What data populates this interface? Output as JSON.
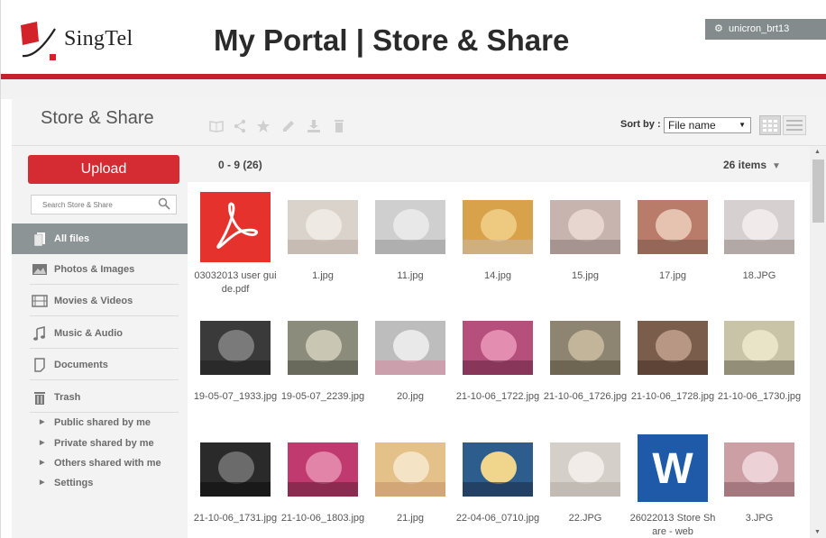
{
  "header": {
    "logo_text": "SingTel",
    "title": "My Portal  |  Store & Share",
    "user": "unicron_brt13"
  },
  "sidebar": {
    "title": "Store & Share",
    "upload_label": "Upload",
    "search_placeholder": "Search Store & Share",
    "nav": [
      {
        "label": "All files",
        "icon": "files-icon",
        "active": true
      },
      {
        "label": "Photos & Images",
        "icon": "image-icon"
      },
      {
        "label": "Movies & Videos",
        "icon": "film-icon"
      },
      {
        "label": "Music & Audio",
        "icon": "music-icon"
      },
      {
        "label": "Documents",
        "icon": "document-icon"
      },
      {
        "label": "Trash",
        "icon": "trash-icon"
      }
    ],
    "sub": [
      {
        "label": "Public shared by me"
      },
      {
        "label": "Private shared by me"
      },
      {
        "label": "Others shared with me"
      },
      {
        "label": "Settings"
      }
    ]
  },
  "toolbar": {
    "icons": [
      "book-icon",
      "share-icon",
      "star-icon",
      "edit-icon",
      "download-icon",
      "trash-icon"
    ],
    "sort_label": "Sort by :",
    "sort_value": "File name",
    "view_icons": [
      "grid-view-icon",
      "list-view-icon"
    ]
  },
  "content": {
    "range": "0 - 9 (26)",
    "count": "26 items",
    "files": [
      {
        "name": "03032013 user guide.pdf",
        "kind": "pdf"
      },
      {
        "name": "1.jpg",
        "kind": "photo"
      },
      {
        "name": "11.jpg",
        "kind": "photo"
      },
      {
        "name": "14.jpg",
        "kind": "photo"
      },
      {
        "name": "15.jpg",
        "kind": "photo"
      },
      {
        "name": "17.jpg",
        "kind": "photo"
      },
      {
        "name": "18.JPG",
        "kind": "photo"
      },
      {
        "name": "19-05-07_1933.jpg",
        "kind": "photo"
      },
      {
        "name": "19-05-07_2239.jpg",
        "kind": "photo"
      },
      {
        "name": "20.jpg",
        "kind": "photo"
      },
      {
        "name": "21-10-06_1722.jpg",
        "kind": "photo"
      },
      {
        "name": "21-10-06_1726.jpg",
        "kind": "photo"
      },
      {
        "name": "21-10-06_1728.jpg",
        "kind": "photo"
      },
      {
        "name": "21-10-06_1730.jpg",
        "kind": "photo"
      },
      {
        "name": "21-10-06_1731.jpg",
        "kind": "photo"
      },
      {
        "name": "21-10-06_1803.jpg",
        "kind": "photo"
      },
      {
        "name": "21.jpg",
        "kind": "photo"
      },
      {
        "name": "22-04-06_0710.jpg",
        "kind": "photo"
      },
      {
        "name": "22.JPG",
        "kind": "photo"
      },
      {
        "name": "26022013 Store Share - web",
        "kind": "word"
      },
      {
        "name": "3.JPG",
        "kind": "photo"
      }
    ]
  }
}
